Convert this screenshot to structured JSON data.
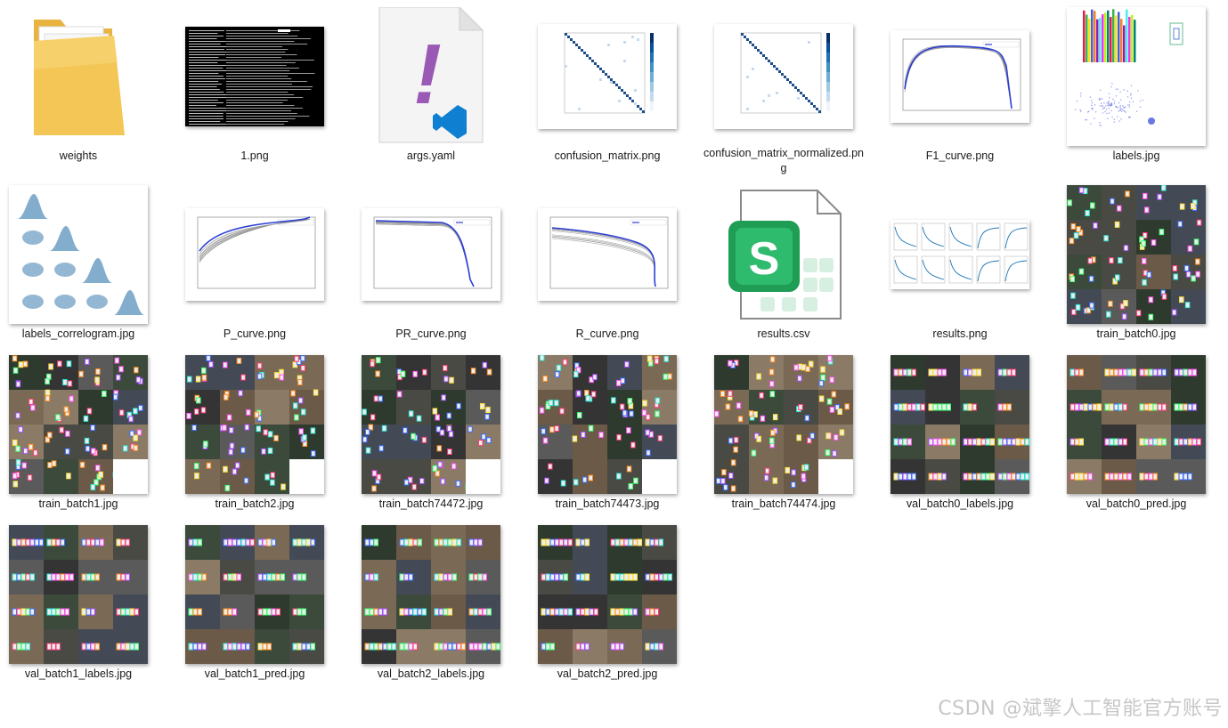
{
  "explorer": {
    "items": [
      {
        "name": "weights",
        "kind": "folder",
        "col": 0,
        "row": 0
      },
      {
        "name": "1.png",
        "kind": "terminal",
        "col": 1,
        "row": 0
      },
      {
        "name": "args.yaml",
        "kind": "yaml",
        "col": 2,
        "row": 0
      },
      {
        "name": "confusion_matrix.png",
        "kind": "matrix",
        "col": 3,
        "row": 0
      },
      {
        "name": "confusion_matrix_normalized.png",
        "kind": "matrix",
        "col": 4,
        "row": 0
      },
      {
        "name": "F1_curve.png",
        "kind": "curve",
        "col": 5,
        "row": 0
      },
      {
        "name": "labels.jpg",
        "kind": "labels",
        "col": 6,
        "row": 0
      },
      {
        "name": "labels_correlogram.jpg",
        "kind": "correlogram",
        "col": 0,
        "row": 1
      },
      {
        "name": "P_curve.png",
        "kind": "pcurve",
        "col": 1,
        "row": 1
      },
      {
        "name": "PR_curve.png",
        "kind": "prcurve",
        "col": 2,
        "row": 1
      },
      {
        "name": "R_curve.png",
        "kind": "rcurve",
        "col": 3,
        "row": 1
      },
      {
        "name": "results.csv",
        "kind": "csv",
        "col": 4,
        "row": 1
      },
      {
        "name": "results.png",
        "kind": "results",
        "col": 5,
        "row": 1
      },
      {
        "name": "train_batch0.jpg",
        "kind": "photo",
        "col": 6,
        "row": 1
      },
      {
        "name": "train_batch1.jpg",
        "kind": "photo",
        "col": 0,
        "row": 2
      },
      {
        "name": "train_batch2.jpg",
        "kind": "photo",
        "col": 1,
        "row": 2
      },
      {
        "name": "train_batch74472.jpg",
        "kind": "photo",
        "col": 2,
        "row": 2
      },
      {
        "name": "train_batch74473.jpg",
        "kind": "photo",
        "col": 3,
        "row": 2
      },
      {
        "name": "train_batch74474.jpg",
        "kind": "photo",
        "col": 4,
        "row": 2
      },
      {
        "name": "val_batch0_labels.jpg",
        "kind": "photo",
        "col": 5,
        "row": 2
      },
      {
        "name": "val_batch0_pred.jpg",
        "kind": "photo",
        "col": 6,
        "row": 2
      },
      {
        "name": "val_batch1_labels.jpg",
        "kind": "photo",
        "col": 0,
        "row": 3
      },
      {
        "name": "val_batch1_pred.jpg",
        "kind": "photo",
        "col": 1,
        "row": 3
      },
      {
        "name": "val_batch2_labels.jpg",
        "kind": "photo",
        "col": 2,
        "row": 3
      },
      {
        "name": "val_batch2_pred.jpg",
        "kind": "photo",
        "col": 3,
        "row": 3
      }
    ]
  },
  "icons": {
    "csv_letter": "S",
    "yaml_mark": "!"
  },
  "watermark": "CSDN @斌擎人工智能官方账号",
  "colors": {
    "folder": "#f3c656",
    "csv_green": "#1f9d55",
    "yaml_purple": "#9b59b6",
    "vscode_blue": "#0e7fd1",
    "curve_blue": "#2b3fd6"
  }
}
